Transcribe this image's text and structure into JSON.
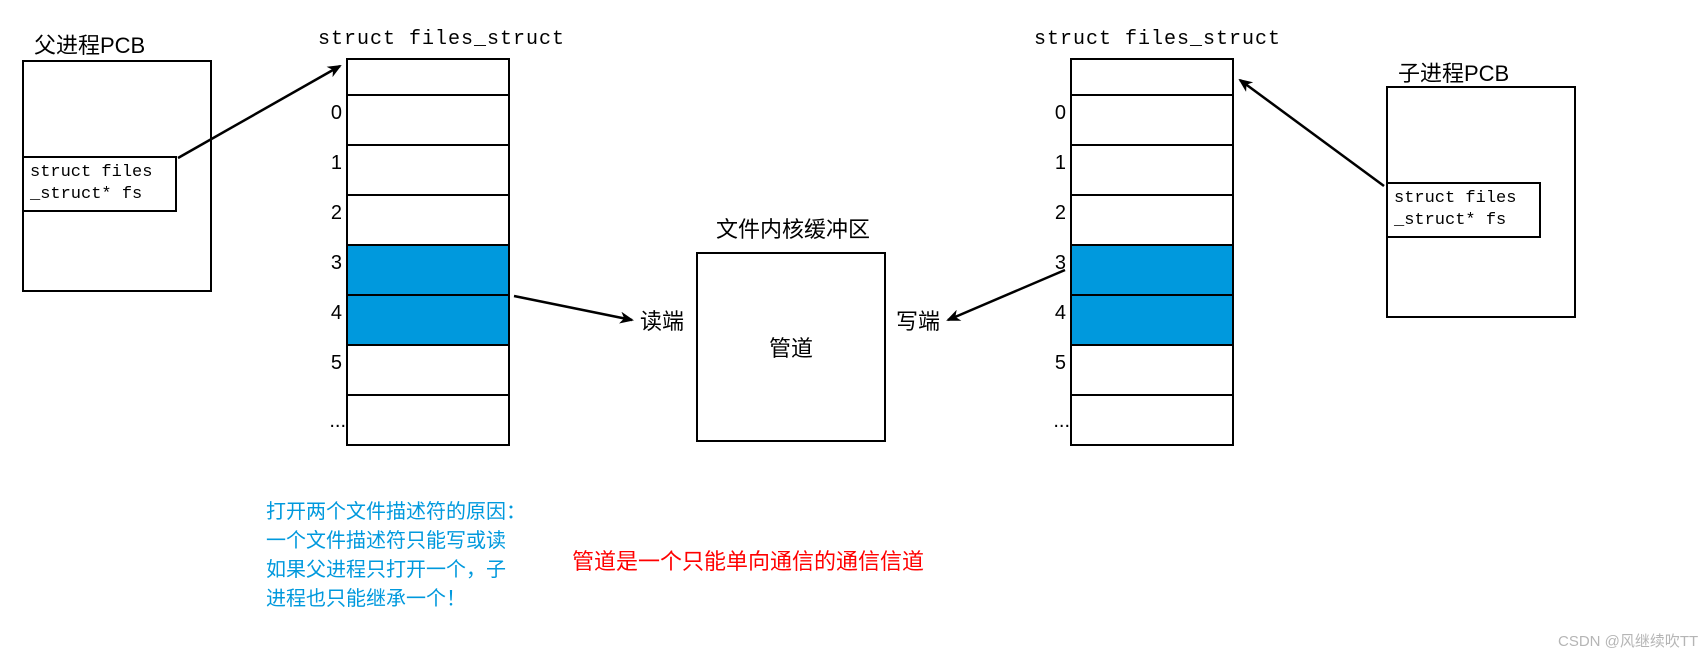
{
  "parent_pcb": {
    "title": "父进程PCB",
    "field": "struct files\n_struct* fs"
  },
  "child_pcb": {
    "title": "子进程PCB",
    "field": "struct files\n_struct* fs"
  },
  "files_struct_left": {
    "title": "struct files_struct",
    "indices": [
      "0",
      "1",
      "2",
      "3",
      "4",
      "5",
      "..."
    ],
    "highlight": [
      3,
      4
    ]
  },
  "files_struct_right": {
    "title": "struct files_struct",
    "indices": [
      "0",
      "1",
      "2",
      "3",
      "4",
      "5",
      "..."
    ],
    "highlight": [
      3,
      4
    ]
  },
  "buffer": {
    "title": "文件内核缓冲区",
    "pipe_label": "管道",
    "read_end": "读端",
    "write_end": "写端"
  },
  "note_blue": "打开两个文件描述符的原因：\n一个文件描述符只能写或读\n如果父进程只打开一个，子\n进程也只能继承一个！",
  "note_red": "管道是一个只能单向通信的通信信道",
  "watermark": "CSDN @风继续吹TT",
  "colors": {
    "highlight": "#0099dd",
    "red": "#ff0000"
  }
}
